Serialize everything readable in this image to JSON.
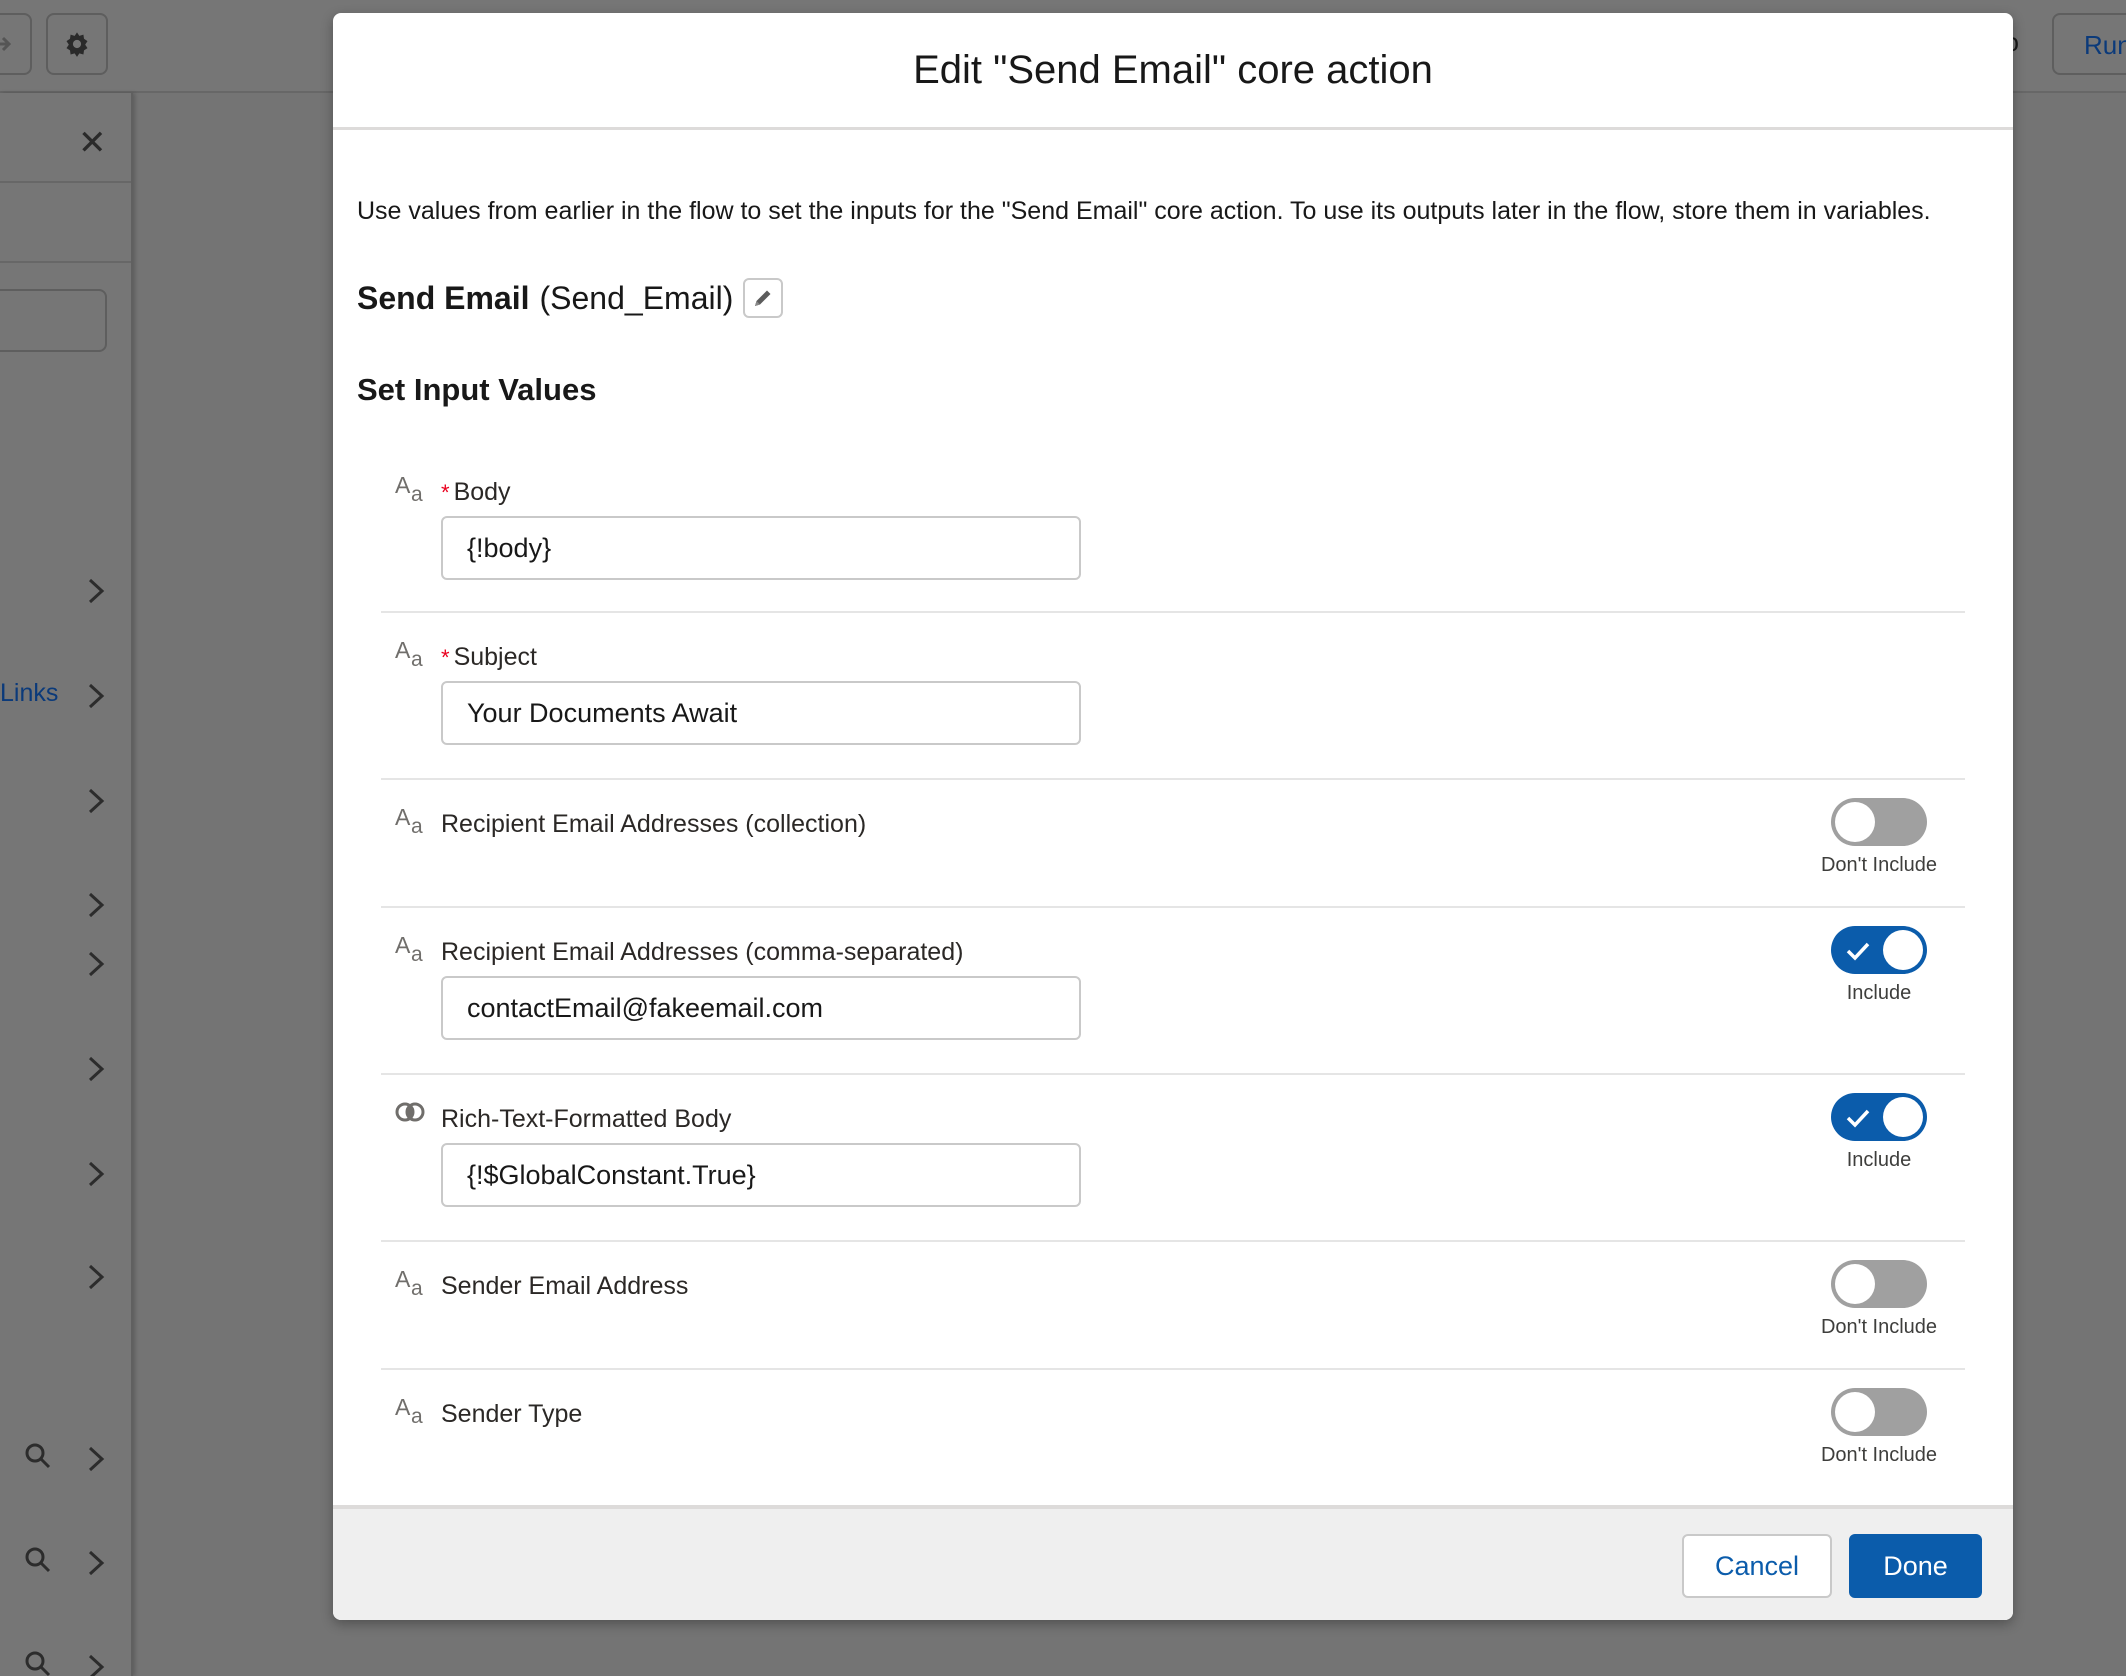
{
  "background": {
    "topbar": {
      "partial_text": "go",
      "run_button_label": "Run"
    },
    "sidebar": {
      "link_label": "Links"
    }
  },
  "modal": {
    "title": "Edit \"Send Email\" core action",
    "intro": "Use values from earlier in the flow to set the inputs for the \"Send Email\" core action. To use its outputs later in the flow, store them in variables.",
    "action_label": "Send Email",
    "action_api_name": "(Send_Email)",
    "section_title": "Set Input Values",
    "fields": [
      {
        "label": "Body",
        "required": "*",
        "type_icon": "text-type-icon",
        "value": "{!body}"
      },
      {
        "label": "Subject",
        "required": "*",
        "type_icon": "text-type-icon",
        "value": "Your Documents Await"
      },
      {
        "label": "Recipient Email Addresses (collection)",
        "type_icon": "text-type-icon",
        "toggle_state": "off",
        "toggle_label": "Don't Include"
      },
      {
        "label": "Recipient Email Addresses (comma-separated)",
        "type_icon": "text-type-icon",
        "value": "contactEmail@fakeemail.com",
        "toggle_state": "on",
        "toggle_label": "Include"
      },
      {
        "label": "Rich-Text-Formatted Body",
        "type_icon": "boolean-type-icon",
        "value": "{!$GlobalConstant.True}",
        "toggle_state": "on",
        "toggle_label": "Include"
      },
      {
        "label": "Sender Email Address",
        "type_icon": "text-type-icon",
        "toggle_state": "off",
        "toggle_label": "Don't Include"
      },
      {
        "label": "Sender Type",
        "type_icon": "text-type-icon",
        "toggle_state": "off",
        "toggle_label": "Don't Include"
      }
    ],
    "footer": {
      "cancel_label": "Cancel",
      "done_label": "Done"
    }
  },
  "colors": {
    "brand": "#0b5cab",
    "required": "#ea001e",
    "toggle_off": "#a0a0a0",
    "overlay": "#747474"
  }
}
